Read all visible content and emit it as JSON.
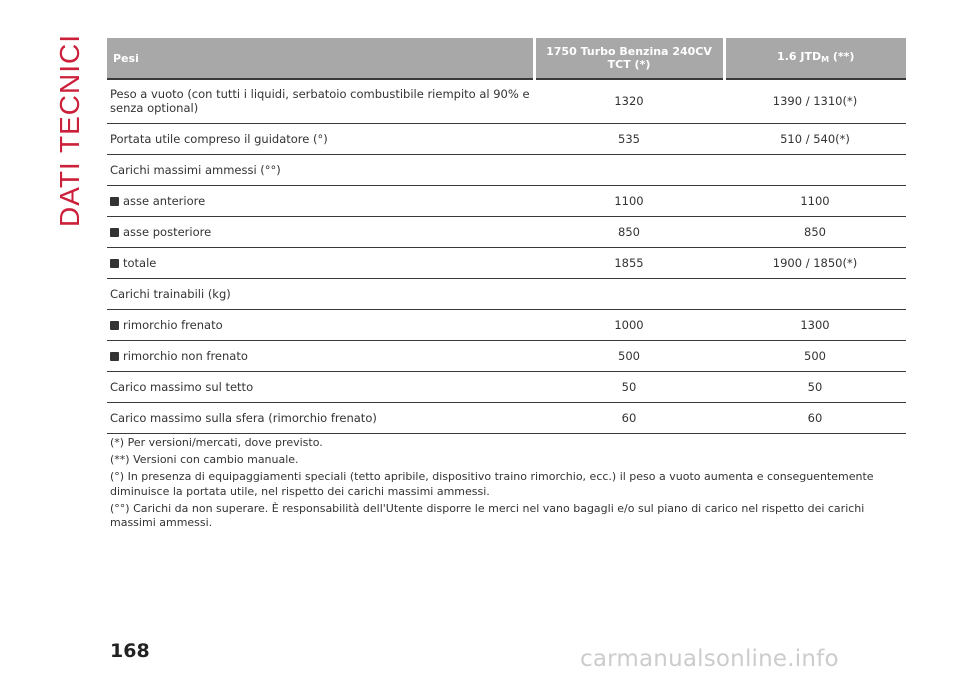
{
  "section_title": "DATI TECNICI",
  "table": {
    "headers": {
      "label": "Pesi",
      "col1": "1750 Turbo Benzina 240CV TCT (*)",
      "col2_main": "1.6 JTD",
      "col2_sub": "M",
      "col2_suffix": " (**)"
    },
    "rows": [
      {
        "label": "Peso a vuoto (con tutti i liquidi, serbatoio combustibile riempito al 90% e senza optional)",
        "v1": "1320",
        "v2": "1390 / 1310(*)"
      },
      {
        "label": "Portata utile compreso il guidatore (°)",
        "v1": "535",
        "v2": "510 / 540(*)"
      },
      {
        "label": "Carichi massimi ammessi (°°)",
        "v1": "",
        "v2": ""
      },
      {
        "label": "asse anteriore",
        "v1": "1100",
        "v2": "1100",
        "bullet": true
      },
      {
        "label": "asse posteriore",
        "v1": "850",
        "v2": "850",
        "bullet": true
      },
      {
        "label": "totale",
        "v1": "1855",
        "v2": "1900 / 1850(*)",
        "bullet": true
      },
      {
        "label": "Carichi trainabili (kg)",
        "v1": "",
        "v2": ""
      },
      {
        "label": "rimorchio frenato",
        "v1": "1000",
        "v2": "1300",
        "bullet": true
      },
      {
        "label": "rimorchio non frenato",
        "v1": "500",
        "v2": "500",
        "bullet": true
      },
      {
        "label": "Carico massimo sul tetto",
        "v1": "50",
        "v2": "50"
      },
      {
        "label": "Carico massimo sulla sfera (rimorchio frenato)",
        "v1": "60",
        "v2": "60"
      }
    ]
  },
  "notes": [
    "(*) Per versioni/mercati, dove previsto.",
    "(**) Versioni con cambio manuale.",
    "(°) In presenza di equipaggiamenti speciali (tetto apribile, dispositivo traino rimorchio, ecc.) il peso a vuoto aumenta e conseguentemente diminuisce la portata utile, nel rispetto dei carichi massimi ammessi.",
    "(°°) Carichi da non superare. È responsabilità dell'Utente disporre le merci nel vano bagagli e/o sul piano di carico nel rispetto dei carichi massimi ammessi."
  ],
  "page_number": "168",
  "watermark": "carmanualsonline.info",
  "colors": {
    "accent": "#cc1f3a",
    "header_bg": "#a8a8a8",
    "rule": "#3a3a3a"
  },
  "icons": {
    "bullet": "square-bullet-icon"
  }
}
